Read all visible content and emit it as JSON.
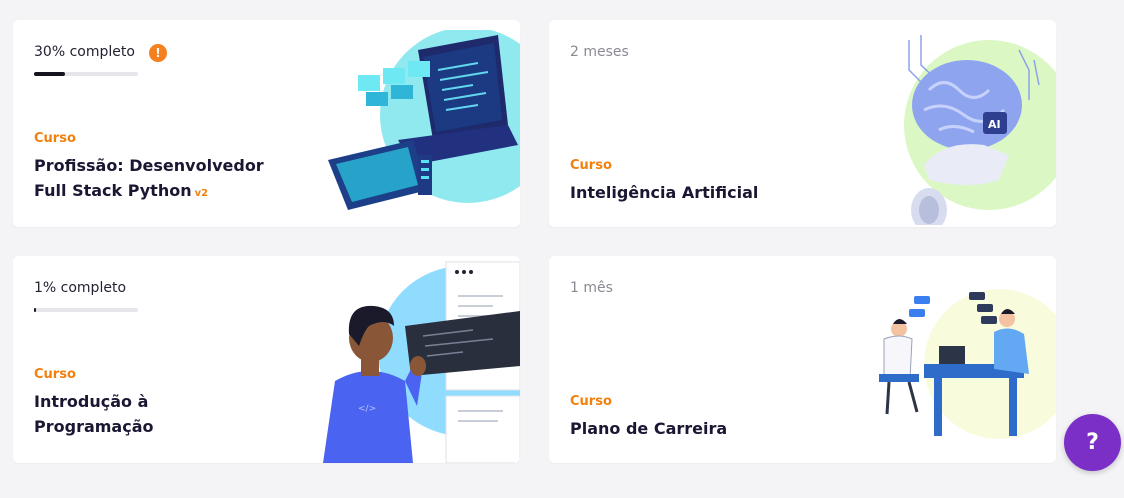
{
  "cards": [
    {
      "progress": "30% completo",
      "progress_value": 0.3,
      "label": "Curso",
      "title": "Profissão: Desenvolvedor Full Stack Python",
      "tag": "v2",
      "has_warning": true,
      "warning_icon": "exclamation-icon"
    },
    {
      "duration": "2 meses",
      "label": "Curso",
      "title": "Inteligência Artificial"
    },
    {
      "progress": "1% completo",
      "progress_value": 0.01,
      "label": "Curso",
      "title": "Introdução à Programação"
    },
    {
      "duration": "1 mês",
      "label": "Curso",
      "title": "Plano de Carreira"
    }
  ],
  "help_button": {
    "label": "?"
  },
  "colors": {
    "accent_orange": "#f2800d",
    "title_dark": "#1a1733",
    "help_purple": "#7b2fc6"
  }
}
